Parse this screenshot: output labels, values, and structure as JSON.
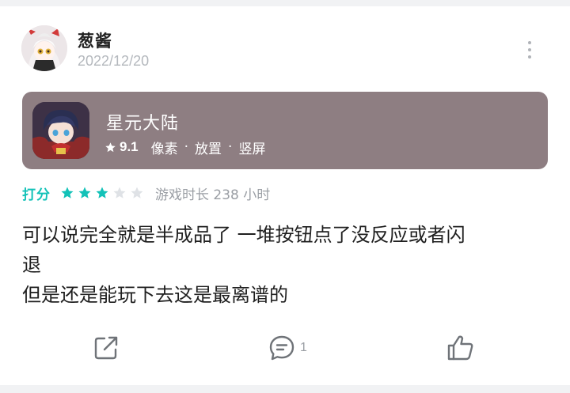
{
  "review": {
    "user": {
      "name": "葱酱",
      "date": "2022/12/20",
      "avatar_icon": "anime-avatar"
    },
    "game": {
      "title": "星元大陆",
      "score": "9.1",
      "tags": [
        "像素",
        "放置",
        "竖屏"
      ],
      "separator": "·",
      "icon": "game-character-icon"
    },
    "rating": {
      "label": "打分",
      "stars": 3,
      "max_stars": 5,
      "playtime": "游戏时长 238 小时"
    },
    "text_lines": [
      "可以说完全就是半成品了 一堆按钮点了没反应或者闪",
      "退",
      "但是还是能玩下去这是最离谱的"
    ],
    "actions": {
      "comment_count": "1"
    }
  },
  "colors": {
    "accent": "#13c2b8",
    "game_card_bg": "#8e7e82",
    "star_empty": "#dfe2e6",
    "muted_text": "#9a9ea4"
  }
}
